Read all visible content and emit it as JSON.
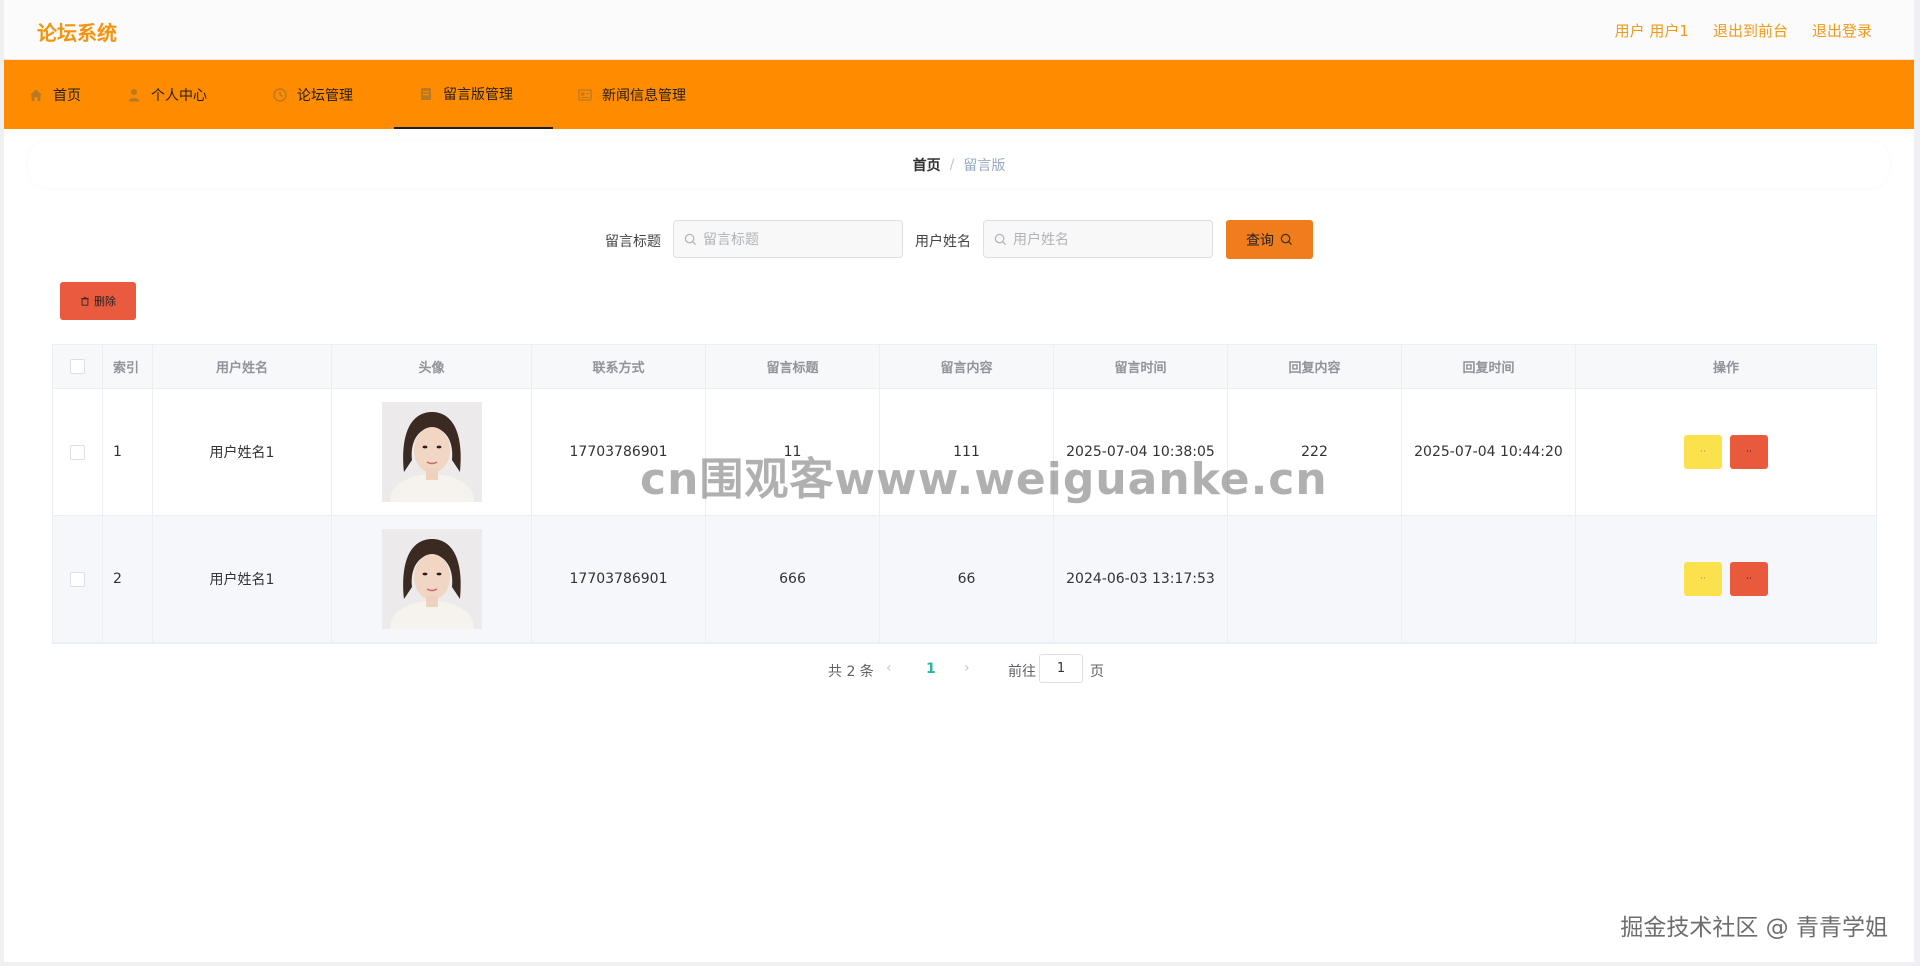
{
  "header": {
    "brand": "论坛系统",
    "user_label": "用户 用户1",
    "to_front_label": "退出到前台",
    "logout_label": "退出登录"
  },
  "nav": {
    "items": [
      {
        "label": "首页",
        "icon": "home-icon"
      },
      {
        "label": "个人中心",
        "icon": "user-icon"
      },
      {
        "label": "论坛管理",
        "icon": "clock-icon"
      },
      {
        "label": "留言版管理",
        "icon": "note-icon",
        "active": true
      },
      {
        "label": "新闻信息管理",
        "icon": "news-icon"
      }
    ]
  },
  "breadcrumb": {
    "home": "首页",
    "separator": "/",
    "current": "留言版"
  },
  "search": {
    "title_label": "留言标题",
    "title_placeholder": "留言标题",
    "name_label": "用户姓名",
    "name_placeholder": "用户姓名",
    "query_label": "查询"
  },
  "actions": {
    "delete_label": "删除"
  },
  "table": {
    "headers": [
      "索引",
      "用户姓名",
      "头像",
      "联系方式",
      "留言标题",
      "留言内容",
      "留言时间",
      "回复内容",
      "回复时间",
      "操作"
    ],
    "rows": [
      {
        "index": "1",
        "name": "用户姓名1",
        "phone": "17703786901",
        "title": "11",
        "content": "111",
        "time": "2025-07-04 10:38:05",
        "reply": "222",
        "reply_time": "2025-07-04 10:44:20"
      },
      {
        "index": "2",
        "name": "用户姓名1",
        "phone": "17703786901",
        "title": "666",
        "content": "66",
        "time": "2024-06-03 13:17:53",
        "reply": "",
        "reply_time": ""
      }
    ],
    "op_labels": {
      "edit": "··",
      "delete": "··"
    }
  },
  "pagination": {
    "total_text": "共 2 条",
    "current_page": "1",
    "goto_label": "前往",
    "goto_value": "1",
    "page_suffix": "页"
  },
  "watermarks": {
    "center": "cn围观客www.weiguanke.cn",
    "corner": "掘金技术社区 @ 青青学姐"
  },
  "colors": {
    "nav_bg": "#ff8c00",
    "brand": "#f3930e",
    "query_button": "#f07c1c",
    "delete_button": "#ea5a3e",
    "op_yellow": "#fbe24d",
    "op_red": "#e95a3d",
    "page_active": "#2cb5a0"
  }
}
